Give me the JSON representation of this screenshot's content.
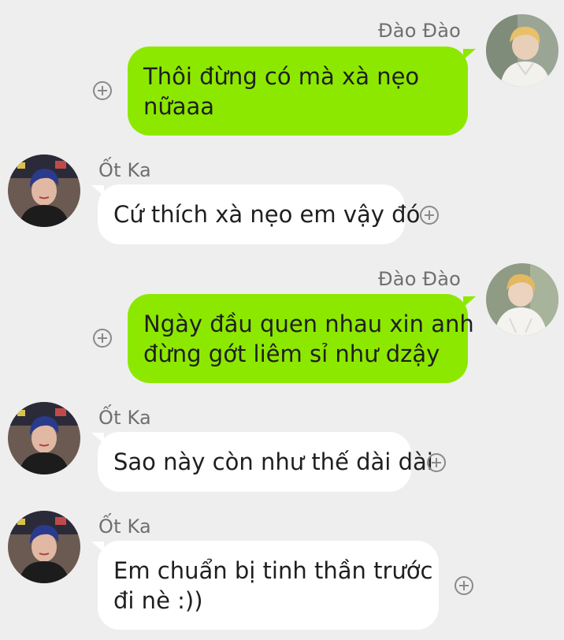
{
  "contacts": {
    "self_name": "Đào Đào",
    "other_name": "Ốt Ka"
  },
  "messages": [
    {
      "direction": "outgoing",
      "sender": "Đào Đào",
      "lines": [
        "Thôi đừng có mà xà nẹo",
        "nữaaa"
      ]
    },
    {
      "direction": "incoming",
      "sender": "Ốt Ka",
      "lines": [
        "Cứ thích xà nẹo em vậy đó"
      ]
    },
    {
      "direction": "outgoing",
      "sender": "Đào Đào",
      "lines": [
        "Ngày đầu quen nhau xin anh",
        "đừng gớt liêm sỉ như dzậy"
      ]
    },
    {
      "direction": "incoming",
      "sender": "Ốt Ka",
      "lines": [
        "Sao này còn như thế dài dài"
      ]
    },
    {
      "direction": "incoming",
      "sender": "Ốt Ka",
      "lines": [
        "Em chuẩn bị tinh thần trước",
        "đi nè :))"
      ]
    }
  ],
  "icons": {
    "react_button": "plus-circle-icon",
    "avatar_self": "avatar-photo",
    "avatar_other": "avatar-photo"
  },
  "colors": {
    "background": "#eeeeee",
    "outgoing_bubble": "#8de800",
    "incoming_bubble": "#ffffff",
    "sender_name": "#6f6f6f",
    "text": "#1f1f1f"
  }
}
